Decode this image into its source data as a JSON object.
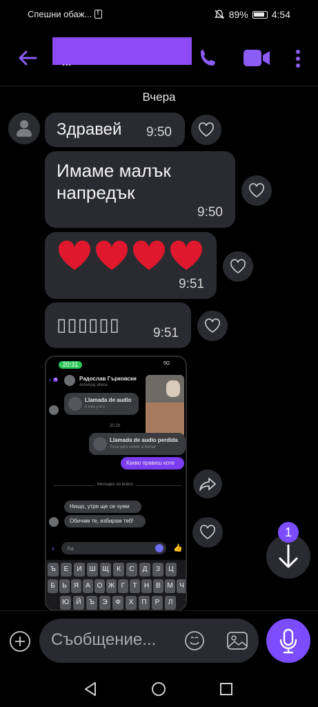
{
  "status_bar": {
    "carrier": "Спешни обаж...",
    "battery": "89%",
    "time": "4:54"
  },
  "header": {
    "contact_name": "..."
  },
  "date_separator": "Вчера",
  "messages": [
    {
      "text": "Здравей",
      "time": "9:50"
    },
    {
      "text_line1": "Имаме малък",
      "text_line2": "напредък",
      "time": "9:50"
    },
    {
      "text": "❤❤❤❤",
      "time": "9:51"
    },
    {
      "text": "▯▯▯▯▯▯",
      "time": "9:51"
    }
  ],
  "shared_screenshot": {
    "status_time": "20:31",
    "network": "5G",
    "contact": "Радослав Гърковски",
    "contact_status": "Activo(a) ahora",
    "back_count": "4",
    "call1_title": "Llamada de audio",
    "call1_sub": "5 min y 4 s",
    "time_sep": "20:28",
    "call2_title": "Llamada de audio perdida",
    "call2_sub": "Toca para volver a llamar",
    "purple_msg": "Какво правиш коте",
    "unread_label": "Mensajes no leídos",
    "reply1": "Нищо, утре ще се чуем",
    "reply2": "Обичам те, избирам теб!",
    "input_placeholder": "Aa",
    "keyboard_row1": [
      "Ъ",
      "Е",
      "И",
      "Ш",
      "Щ",
      "К",
      "С",
      "Д",
      "З",
      "Ц"
    ],
    "keyboard_row2": [
      "Б",
      "Ь",
      "Я",
      "А",
      "О",
      "Ж",
      "Г",
      "Т",
      "Н",
      "В",
      "М",
      "Ч"
    ],
    "keyboard_row3": [
      "Ю",
      "Й",
      "Ъ",
      "Э",
      "Ф",
      "Х",
      "П",
      "Р",
      "Л"
    ]
  },
  "unread_count": "1",
  "composer": {
    "placeholder": "Съобщение..."
  },
  "colors": {
    "accent": "#7c4dff",
    "bubble": "#2a2b30",
    "heart": "#e0182d"
  }
}
